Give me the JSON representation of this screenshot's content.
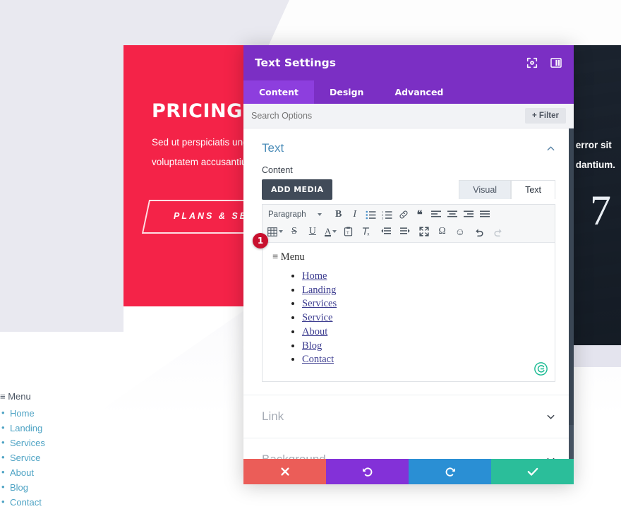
{
  "background": {
    "hero": {
      "title": "PRICING & PLANS",
      "paragraph_line1": "Sed ut perspiciatis unde omnis iste natus error sit",
      "paragraph_line2": "voluptatem accusantium doloremque laudantium.",
      "button_label": "PLANS & SERVICES",
      "red_color": "#f42348",
      "number": "7"
    },
    "menu": {
      "heading": "≡ Menu",
      "items": [
        "Home",
        "Landing",
        "Services",
        "Service",
        "About",
        "Blog",
        "Contact"
      ],
      "link_color": "#4ea3c4"
    }
  },
  "modal": {
    "title": "Text Settings",
    "accent_color": "#7b2fc4",
    "header_icons": [
      {
        "name": "target-icon",
        "label": "Focus"
      },
      {
        "name": "layout-panel-icon",
        "label": "Layout"
      }
    ],
    "tabs": [
      {
        "label": "Content",
        "active": true
      },
      {
        "label": "Design",
        "active": false
      },
      {
        "label": "Advanced",
        "active": false
      }
    ],
    "search": {
      "placeholder": "Search Options",
      "value": "",
      "filter_label": "Filter",
      "filter_icon": "plus-icon"
    },
    "section": {
      "title": "Text",
      "collapse_icon": "chevron-up-icon",
      "field_label": "Content",
      "add_media_label": "ADD MEDIA",
      "editor_tabs": [
        {
          "label": "Visual",
          "active": false
        },
        {
          "label": "Text",
          "active": true
        }
      ]
    },
    "toolbar": {
      "row1": [
        {
          "name": "paragraph-format-select",
          "label": "Paragraph"
        },
        {
          "name": "bold-icon",
          "glyph": "B"
        },
        {
          "name": "italic-icon",
          "glyph": "I"
        },
        {
          "name": "bullet-list-icon",
          "glyph": "☰"
        },
        {
          "name": "numbered-list-icon",
          "glyph": "☰"
        },
        {
          "name": "link-icon",
          "glyph": "🔗"
        },
        {
          "name": "blockquote-icon",
          "glyph": "❝"
        },
        {
          "name": "align-left-icon",
          "glyph": "≡"
        },
        {
          "name": "align-center-icon",
          "glyph": "≡"
        },
        {
          "name": "align-right-icon",
          "glyph": "≡"
        },
        {
          "name": "align-justify-icon",
          "glyph": "≡"
        }
      ],
      "row2": [
        {
          "name": "table-icon",
          "glyph": "⊞"
        },
        {
          "name": "strikethrough-icon",
          "glyph": "S"
        },
        {
          "name": "underline-icon",
          "glyph": "U"
        },
        {
          "name": "text-color-icon",
          "glyph": "A"
        },
        {
          "name": "paste-as-text-icon",
          "glyph": "📋"
        },
        {
          "name": "clear-formatting-icon",
          "glyph": "Tx"
        },
        {
          "name": "outdent-icon",
          "glyph": "⇤"
        },
        {
          "name": "indent-icon",
          "glyph": "⇥"
        },
        {
          "name": "fullscreen-icon",
          "glyph": "⛶"
        },
        {
          "name": "special-character-icon",
          "glyph": "Ω"
        },
        {
          "name": "emoji-icon",
          "glyph": "☺"
        },
        {
          "name": "undo-icon",
          "glyph": "↩"
        },
        {
          "name": "redo-icon",
          "glyph": "↪"
        }
      ]
    },
    "editor_content": {
      "badge": "1",
      "menu_heading": "≡ Menu",
      "items": [
        "Home",
        "Landing",
        "Services",
        "Service",
        "About",
        "Blog",
        "Contact"
      ],
      "grammarly_icon": "grammarly-icon"
    },
    "accordions": [
      {
        "label": "Link",
        "icon": "chevron-down-icon"
      },
      {
        "label": "Background",
        "icon": "chevron-down-icon"
      }
    ],
    "footer_buttons": [
      {
        "name": "cancel-button",
        "icon": "close-icon",
        "color": "#eb5d58"
      },
      {
        "name": "undo-button",
        "icon": "undo-arrow-icon",
        "color": "#8331d8"
      },
      {
        "name": "redo-button",
        "icon": "redo-arrow-icon",
        "color": "#2a8fd4"
      },
      {
        "name": "save-button",
        "icon": "check-icon",
        "color": "#2bbe9a"
      }
    ]
  }
}
